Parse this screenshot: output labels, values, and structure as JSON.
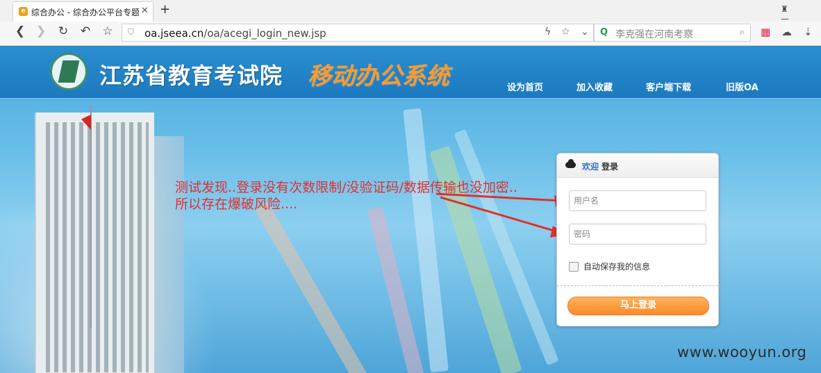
{
  "browser": {
    "tab_title": "综合办公 - 综合办公平台专题",
    "url_host": "oa.jseea.cn",
    "url_path": "/oa/acegi_login_new.jsp",
    "search_text": "李克强在河南考察"
  },
  "header": {
    "title": "江苏省教育考试院",
    "subtitle": "移动办公系统",
    "links": [
      "设为首页",
      "加入收藏",
      "客户端下载",
      "旧版OA"
    ]
  },
  "annotation": {
    "line1": "测试发现..登录没有次数限制/没验证码/数据传输也没加密..",
    "line2": "所以存在爆破风险...."
  },
  "login": {
    "welcome": "欢迎",
    "title": "登录",
    "username_placeholder": "用户名",
    "password_placeholder": "密码",
    "remember_label": "自动保存我的信息",
    "submit_label": "马上登录"
  },
  "watermark": "www.wooyun.org",
  "colors": {
    "header_blue": "#1c79bf",
    "subtitle_orange": "#ff9a2a",
    "annotation_red": "#e0302e",
    "button_orange": "#f98b2b"
  }
}
